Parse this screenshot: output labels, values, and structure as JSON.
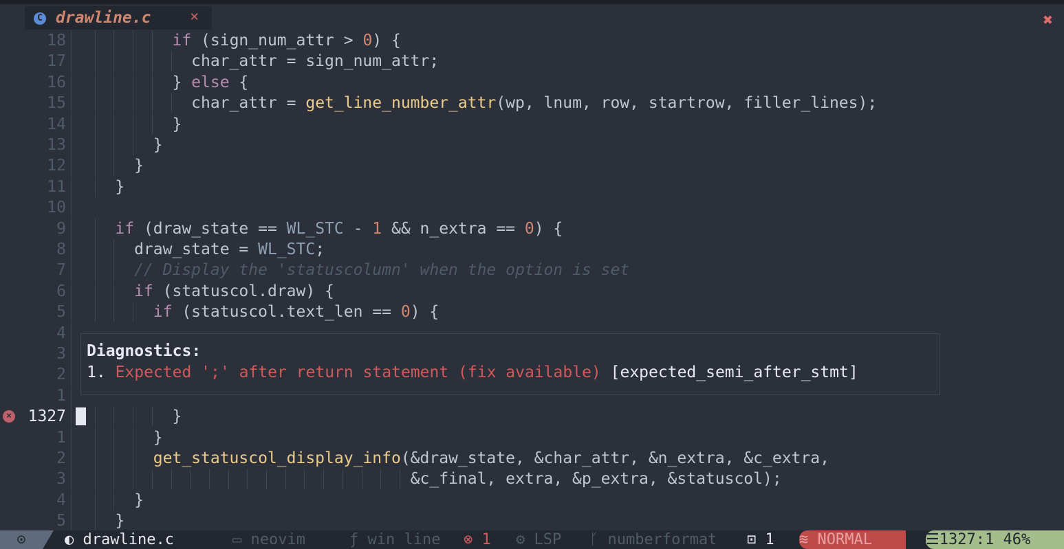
{
  "tab": {
    "icon": "c-language-icon",
    "filename": "drawline.c",
    "close": "×"
  },
  "window_close": "✖",
  "lines": [
    {
      "num": "18",
      "code": "          if (sign_num_attr > 0) {"
    },
    {
      "num": "17",
      "code": "            char_attr = sign_num_attr;"
    },
    {
      "num": "16",
      "code": "          } else {"
    },
    {
      "num": "15",
      "code": "            char_attr = get_line_number_attr(wp, lnum, row, startrow, filler_lines);"
    },
    {
      "num": "14",
      "code": "          }"
    },
    {
      "num": "13",
      "code": "        }"
    },
    {
      "num": "12",
      "code": "      }"
    },
    {
      "num": "11",
      "code": "    }"
    },
    {
      "num": "10",
      "code": ""
    },
    {
      "num": "9",
      "code": "    if (draw_state == WL_STC - 1 && n_extra == 0) {"
    },
    {
      "num": "8",
      "code": "      draw_state = WL_STC;"
    },
    {
      "num": "7",
      "code": "      // Display the 'statuscolumn' when the option is set"
    },
    {
      "num": "6",
      "code": "      if (statuscol.draw) {"
    },
    {
      "num": "5",
      "code": "        if (statuscol.text_len == 0) {"
    },
    {
      "num": "4",
      "code": ""
    },
    {
      "num": "3",
      "code": ""
    },
    {
      "num": "2",
      "code": ""
    },
    {
      "num": "1",
      "code": ""
    },
    {
      "num": "1327",
      "code": "          }"
    },
    {
      "num": "1",
      "code": "        }"
    },
    {
      "num": "2",
      "code": "        get_statuscol_display_info(&draw_state, &char_attr, &n_extra, &c_extra,"
    },
    {
      "num": "3",
      "code": "                                   &c_final, extra, &p_extra, &statuscol);"
    },
    {
      "num": "4",
      "code": "      }"
    },
    {
      "num": "5",
      "code": "    }"
    }
  ],
  "diagnostics": {
    "title": "Diagnostics:",
    "items": [
      {
        "num": "1.",
        "message": "Expected ';' after return statement (fix available)",
        "code": "[expected_semi_after_stmt]"
      }
    ]
  },
  "statusbar": {
    "mode_icon": "vim-icon",
    "filename": "drawline.c",
    "folder": "neovim",
    "function": "win line",
    "errors": "1",
    "lsp": "LSP",
    "branch": "numberformat",
    "buffers": "1",
    "mode": "NORMAL",
    "position": "1327:1",
    "percent": "46%"
  },
  "colors": {
    "background": "#2b303b",
    "keyword": "#b48ead",
    "function": "#ebcb8b",
    "constant": "#8fa1b3",
    "number": "#d08770",
    "comment": "#4f5b66",
    "error": "#bf616a",
    "mode_bg": "#bf4a4a",
    "position_bg": "#a3be8c"
  }
}
